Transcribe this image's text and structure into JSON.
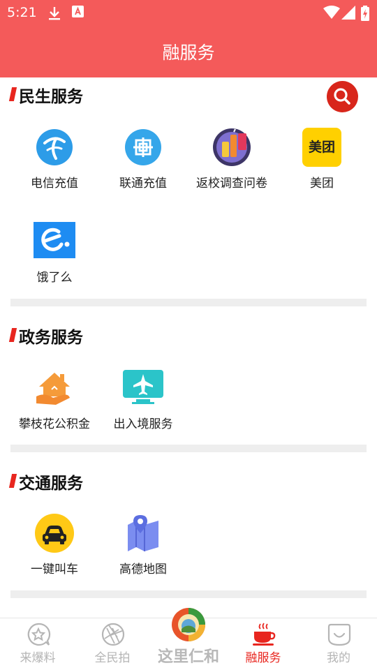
{
  "status_bar": {
    "time": "5:21"
  },
  "header": {
    "title": "融服务"
  },
  "sections": [
    {
      "title": "民生服务",
      "items": [
        {
          "label": "电信充值",
          "icon": "china-telecom-icon"
        },
        {
          "label": "联通充值",
          "icon": "china-unicom-icon"
        },
        {
          "label": "返校调查问卷",
          "icon": "survey-icon"
        },
        {
          "label": "美团",
          "icon": "meituan-icon",
          "icon_text": "美团"
        },
        {
          "label": "饿了么",
          "icon": "eleme-icon"
        }
      ]
    },
    {
      "title": "政务服务",
      "items": [
        {
          "label": "攀枝花公积金",
          "icon": "housing-fund-icon"
        },
        {
          "label": "出入境服务",
          "icon": "airplane-icon"
        }
      ]
    },
    {
      "title": "交通服务",
      "items": [
        {
          "label": "一键叫车",
          "icon": "taxi-icon"
        },
        {
          "label": "高德地图",
          "icon": "map-icon"
        }
      ]
    }
  ],
  "bottom_nav": {
    "items": [
      {
        "label": "来爆料",
        "icon": "star-bubble-icon"
      },
      {
        "label": "全民拍",
        "icon": "camera-shutter-icon"
      },
      {
        "label": "融服务",
        "icon": "coffee-cup-icon",
        "active": true
      },
      {
        "label": "我的",
        "icon": "smile-face-icon"
      }
    ],
    "center": {
      "label": "这里仁和",
      "icon": "renhe-logo-icon"
    }
  },
  "colors": {
    "header_bg": "#f45a5a",
    "accent_red": "#e8261f",
    "inactive_gray": "#b5b5b5"
  }
}
